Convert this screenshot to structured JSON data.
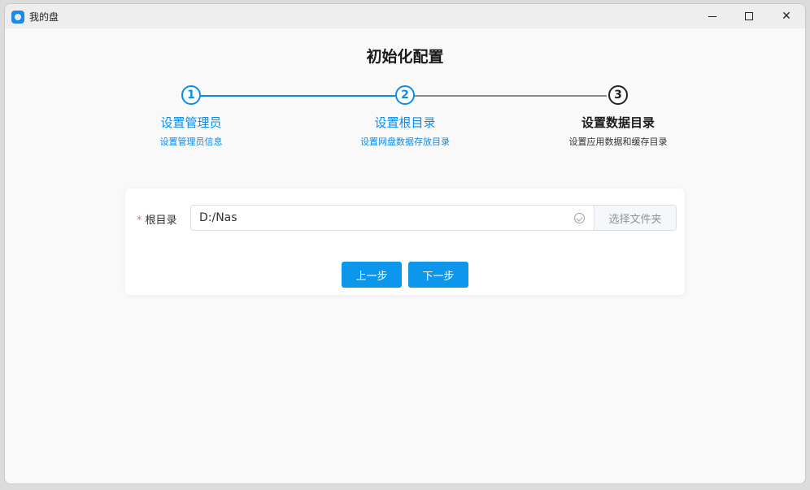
{
  "window": {
    "title": "我的盘",
    "controls": [
      "minimize-icon",
      "maximize-icon",
      "close-icon"
    ]
  },
  "page": {
    "heading": "初始化配置"
  },
  "steps": [
    {
      "number": "1",
      "title": "设置管理员",
      "desc": "设置管理员信息",
      "status": "done"
    },
    {
      "number": "2",
      "title": "设置根目录",
      "desc": "设置网盘数据存放目录",
      "status": "done"
    },
    {
      "number": "3",
      "title": "设置数据目录",
      "desc": "设置应用数据和缓存目录",
      "status": "current"
    }
  ],
  "form": {
    "required_mark": "*",
    "root_label": "根目录",
    "root_value": "D:/Nas",
    "choose_folder_label": "选择文件夹"
  },
  "buttons": {
    "prev": "上一步",
    "next": "下一步"
  },
  "colors": {
    "accent": "#0c8ce9",
    "button": "#0c97ec",
    "required": "#f56c6c"
  }
}
